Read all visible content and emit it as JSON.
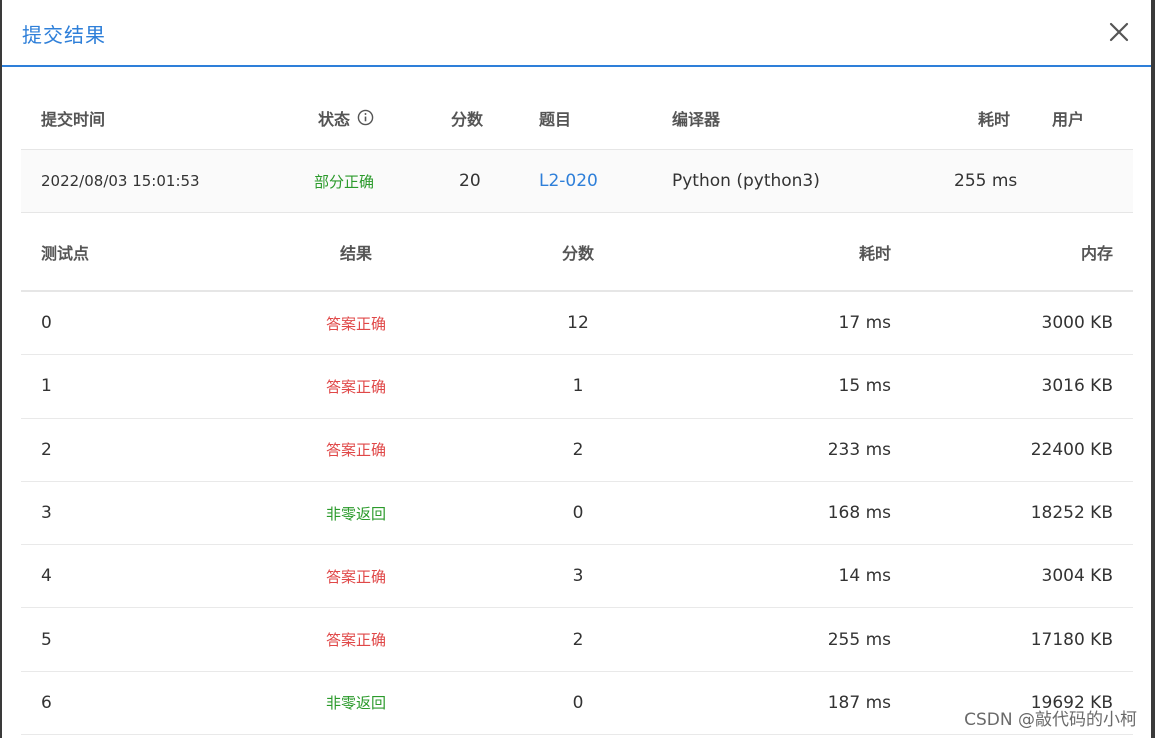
{
  "dialog": {
    "title": "提交结果"
  },
  "summary": {
    "headers": {
      "time": "提交时间",
      "status": "状态",
      "score": "分数",
      "problem": "题目",
      "compiler": "编译器",
      "duration": "耗时",
      "user": "用户"
    },
    "row": {
      "time": "2022/08/03 15:01:53",
      "status": "部分正确",
      "score": "20",
      "problem": "L2-020",
      "compiler": "Python (python3)",
      "duration": "255 ms",
      "user": ""
    }
  },
  "detail": {
    "headers": {
      "case": "测试点",
      "result": "结果",
      "score": "分数",
      "duration": "耗时",
      "memory": "内存"
    },
    "rows": [
      {
        "case": "0",
        "result": "答案正确",
        "result_type": "correct",
        "score": "12",
        "duration": "17 ms",
        "memory": "3000 KB"
      },
      {
        "case": "1",
        "result": "答案正确",
        "result_type": "correct",
        "score": "1",
        "duration": "15 ms",
        "memory": "3016 KB"
      },
      {
        "case": "2",
        "result": "答案正确",
        "result_type": "correct",
        "score": "2",
        "duration": "233 ms",
        "memory": "22400 KB"
      },
      {
        "case": "3",
        "result": "非零返回",
        "result_type": "nonzero",
        "score": "0",
        "duration": "168 ms",
        "memory": "18252 KB"
      },
      {
        "case": "4",
        "result": "答案正确",
        "result_type": "correct",
        "score": "3",
        "duration": "14 ms",
        "memory": "3004 KB"
      },
      {
        "case": "5",
        "result": "答案正确",
        "result_type": "correct",
        "score": "2",
        "duration": "255 ms",
        "memory": "17180 KB"
      },
      {
        "case": "6",
        "result": "非零返回",
        "result_type": "nonzero",
        "score": "0",
        "duration": "187 ms",
        "memory": "19692 KB"
      }
    ]
  },
  "watermark": "CSDN @敲代码的小柯",
  "colors": {
    "accent": "#2e7fd9",
    "correct": "#e04848",
    "nonzero": "#2b9a2b",
    "partial": "#2b9a2b"
  }
}
